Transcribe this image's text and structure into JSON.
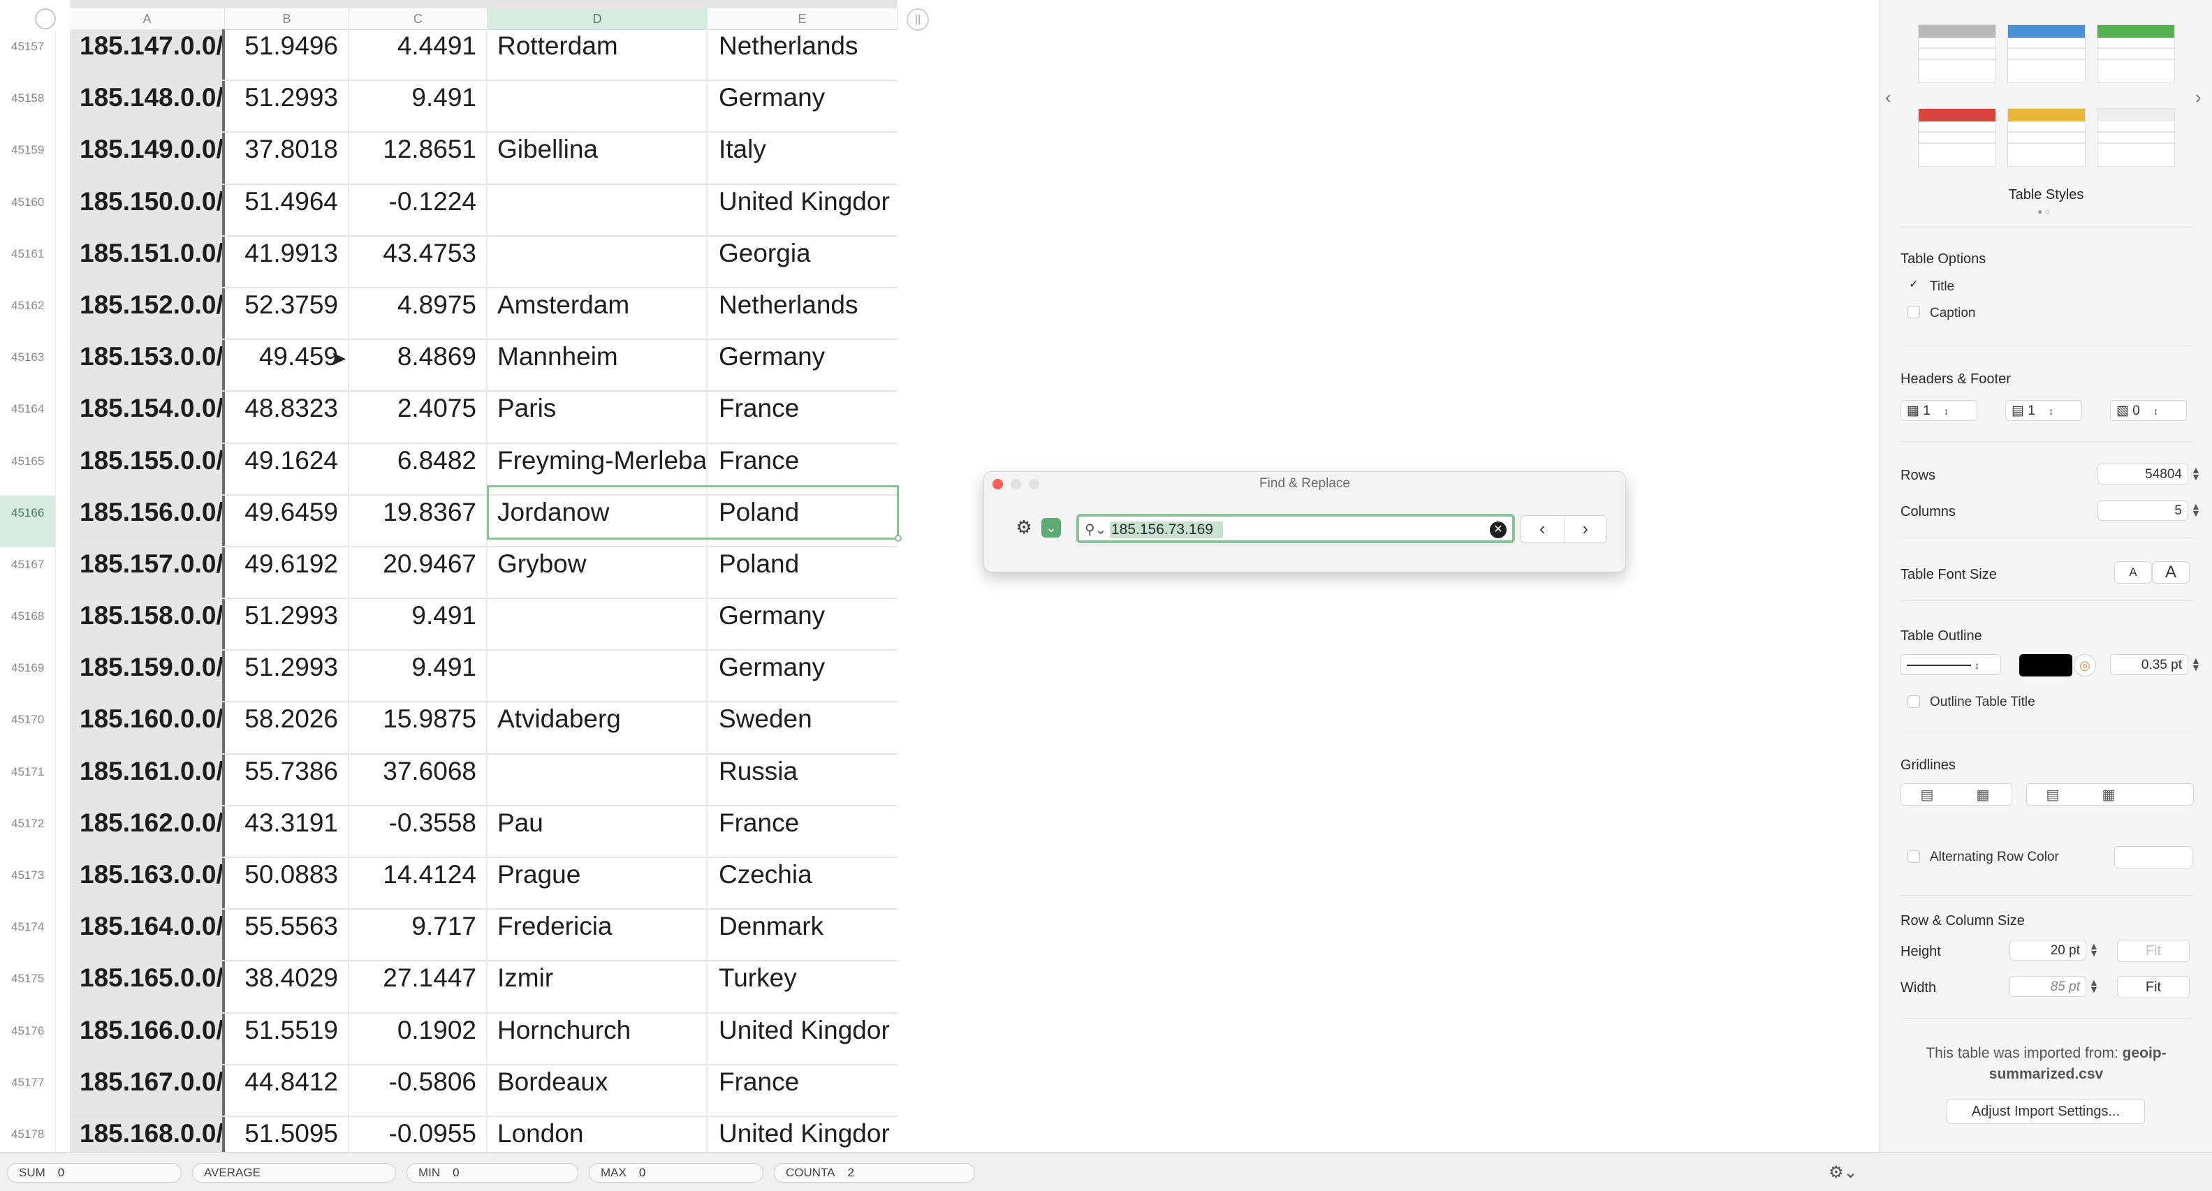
{
  "sheet": {
    "columns": [
      "A",
      "B",
      "C",
      "D",
      "E"
    ],
    "selected_column": "D",
    "rows": [
      {
        "num": "45157",
        "a": "185.147.0.0/",
        "b": "51.9496",
        "c": "4.4491",
        "d": "Rotterdam",
        "e": "Netherlands"
      },
      {
        "num": "45158",
        "a": "185.148.0.0/",
        "b": "51.2993",
        "c": "9.491",
        "d": "",
        "e": "Germany"
      },
      {
        "num": "45159",
        "a": "185.149.0.0/",
        "b": "37.8018",
        "c": "12.8651",
        "d": "Gibellina",
        "e": "Italy"
      },
      {
        "num": "45160",
        "a": "185.150.0.0/",
        "b": "51.4964",
        "c": "-0.1224",
        "d": "",
        "e": "United Kingdor"
      },
      {
        "num": "45161",
        "a": "185.151.0.0/",
        "b": "41.9913",
        "c": "43.4753",
        "d": "",
        "e": "Georgia"
      },
      {
        "num": "45162",
        "a": "185.152.0.0/",
        "b": "52.3759",
        "c": "4.8975",
        "d": "Amsterdam",
        "e": "Netherlands"
      },
      {
        "num": "45163",
        "a": "185.153.0.0/",
        "b": "49.459",
        "c": "8.4869",
        "d": "Mannheim",
        "e": "Germany"
      },
      {
        "num": "45164",
        "a": "185.154.0.0/",
        "b": "48.8323",
        "c": "2.4075",
        "d": "Paris",
        "e": "France"
      },
      {
        "num": "45165",
        "a": "185.155.0.0/",
        "b": "49.1624",
        "c": "6.8482",
        "d": "Freyming-Merleba",
        "e": "France"
      },
      {
        "num": "45166",
        "a": "185.156.0.0/",
        "b": "49.6459",
        "c": "19.8367",
        "d": "Jordanow",
        "e": "Poland"
      },
      {
        "num": "45167",
        "a": "185.157.0.0/",
        "b": "49.6192",
        "c": "20.9467",
        "d": "Grybow",
        "e": "Poland"
      },
      {
        "num": "45168",
        "a": "185.158.0.0/",
        "b": "51.2993",
        "c": "9.491",
        "d": "",
        "e": "Germany"
      },
      {
        "num": "45169",
        "a": "185.159.0.0/",
        "b": "51.2993",
        "c": "9.491",
        "d": "",
        "e": "Germany"
      },
      {
        "num": "45170",
        "a": "185.160.0.0/",
        "b": "58.2026",
        "c": "15.9875",
        "d": "Atvidaberg",
        "e": "Sweden"
      },
      {
        "num": "45171",
        "a": "185.161.0.0/",
        "b": "55.7386",
        "c": "37.6068",
        "d": "",
        "e": "Russia"
      },
      {
        "num": "45172",
        "a": "185.162.0.0/",
        "b": "43.3191",
        "c": "-0.3558",
        "d": "Pau",
        "e": "France"
      },
      {
        "num": "45173",
        "a": "185.163.0.0/",
        "b": "50.0883",
        "c": "14.4124",
        "d": "Prague",
        "e": "Czechia"
      },
      {
        "num": "45174",
        "a": "185.164.0.0/",
        "b": "55.5563",
        "c": "9.717",
        "d": "Fredericia",
        "e": "Denmark"
      },
      {
        "num": "45175",
        "a": "185.165.0.0/",
        "b": "38.4029",
        "c": "27.1447",
        "d": "Izmir",
        "e": "Turkey"
      },
      {
        "num": "45176",
        "a": "185.166.0.0/",
        "b": "51.5519",
        "c": "0.1902",
        "d": "Hornchurch",
        "e": "United Kingdor"
      },
      {
        "num": "45177",
        "a": "185.167.0.0/",
        "b": "44.8412",
        "c": "-0.5806",
        "d": "Bordeaux",
        "e": "France"
      },
      {
        "num": "45178",
        "a": "185.168.0.0/",
        "b": "51.5095",
        "c": "-0.0955",
        "d": "London",
        "e": "United Kingdor"
      }
    ],
    "selected_row": "45166"
  },
  "find": {
    "title": "Find & Replace",
    "query": "185.156.73.169",
    "prev_icon": "chevron-left-icon",
    "next_icon": "chevron-right-icon"
  },
  "inspector": {
    "table_styles_label": "Table Styles",
    "style_colors": [
      "#b9b9b9",
      "#4a90d9",
      "#55b050",
      "#d9453d",
      "#e8b73a",
      "#ededed"
    ],
    "table_options_label": "Table Options",
    "title_option": "Title",
    "title_checked": true,
    "caption_option": "Caption",
    "caption_checked": false,
    "headers_footer_label": "Headers & Footer",
    "header_rows": "1",
    "header_cols": "1",
    "footer_rows": "0",
    "rows_label": "Rows",
    "rows_value": "54804",
    "columns_label": "Columns",
    "columns_value": "5",
    "font_size_label": "Table Font Size",
    "font_small": "A",
    "font_large": "A",
    "outline_label": "Table Outline",
    "outline_color": "#000000",
    "outline_width": "0.35 pt",
    "outline_title_label": "Outline Table Title",
    "gridlines_label": "Gridlines",
    "alt_row_label": "Alternating Row Color",
    "row_col_size_label": "Row & Column Size",
    "height_label": "Height",
    "height_value": "20 pt",
    "width_label": "Width",
    "width_value": "85 pt",
    "fit_label": "Fit",
    "import_note_line1": "This table was imported from:",
    "import_file_a": "geoip-",
    "import_file_b": "summarized.csv",
    "adjust_import_label": "Adjust Import Settings..."
  },
  "status": {
    "sum_label": "SUM",
    "sum_value": "0",
    "avg_label": "AVERAGE",
    "avg_value": "",
    "min_label": "MIN",
    "min_value": "0",
    "max_label": "MAX",
    "max_value": "0",
    "counta_label": "COUNTA",
    "counta_value": "2"
  }
}
